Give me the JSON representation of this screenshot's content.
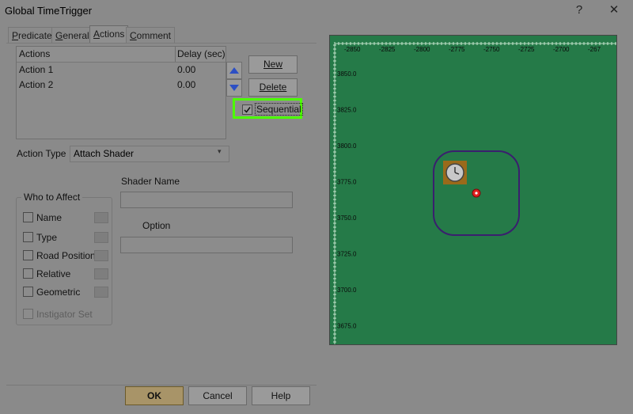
{
  "window": {
    "title": "Global TimeTrigger",
    "help_glyph": "?",
    "close_glyph": "✕"
  },
  "tabs": [
    {
      "label": "Predicate",
      "mnemonic": "P",
      "rest": "redicate"
    },
    {
      "label": "General",
      "mnemonic": "G",
      "rest": "eneral"
    },
    {
      "label": "Actions",
      "mnemonic": "A",
      "rest": "ctions"
    },
    {
      "label": "Comment",
      "mnemonic": "C",
      "rest": "omment"
    }
  ],
  "actions_table": {
    "headers": [
      "Actions",
      "Delay (sec)"
    ],
    "rows": [
      {
        "name": "Action 1",
        "delay": "0.00"
      },
      {
        "name": "Action 2",
        "delay": "0.00"
      }
    ]
  },
  "buttons": {
    "new": "New",
    "delete": "Delete",
    "ok": "OK",
    "cancel": "Cancel",
    "help": "Help"
  },
  "sequential": {
    "label": "Sequential",
    "checked": true
  },
  "action_type": {
    "label": "Action Type",
    "value": "Attach Shader"
  },
  "shader_name": {
    "label": "Shader Name",
    "value": ""
  },
  "option": {
    "label": "Option",
    "value": ""
  },
  "who_to_affect": {
    "title": "Who to Affect",
    "items": [
      {
        "label": "Name"
      },
      {
        "label": "Type"
      },
      {
        "label": "Road Position"
      },
      {
        "label": "Relative"
      },
      {
        "label": "Geometric"
      }
    ],
    "instigator": "Instigator Set"
  },
  "map": {
    "x_ticks": [
      "-2850",
      "-2825",
      "-2800",
      "-2775",
      "-2750",
      "-2725",
      "-2700",
      "-267"
    ],
    "y_ticks": [
      "3850.0",
      "3825.0",
      "3800.0",
      "3775.0",
      "3750.0",
      "3725.0",
      "3700.0",
      "3675.0"
    ],
    "background": "#257a48",
    "zone_color": "#3a1f6e",
    "marker_color": "#e02020",
    "icon": "clock-icon"
  }
}
